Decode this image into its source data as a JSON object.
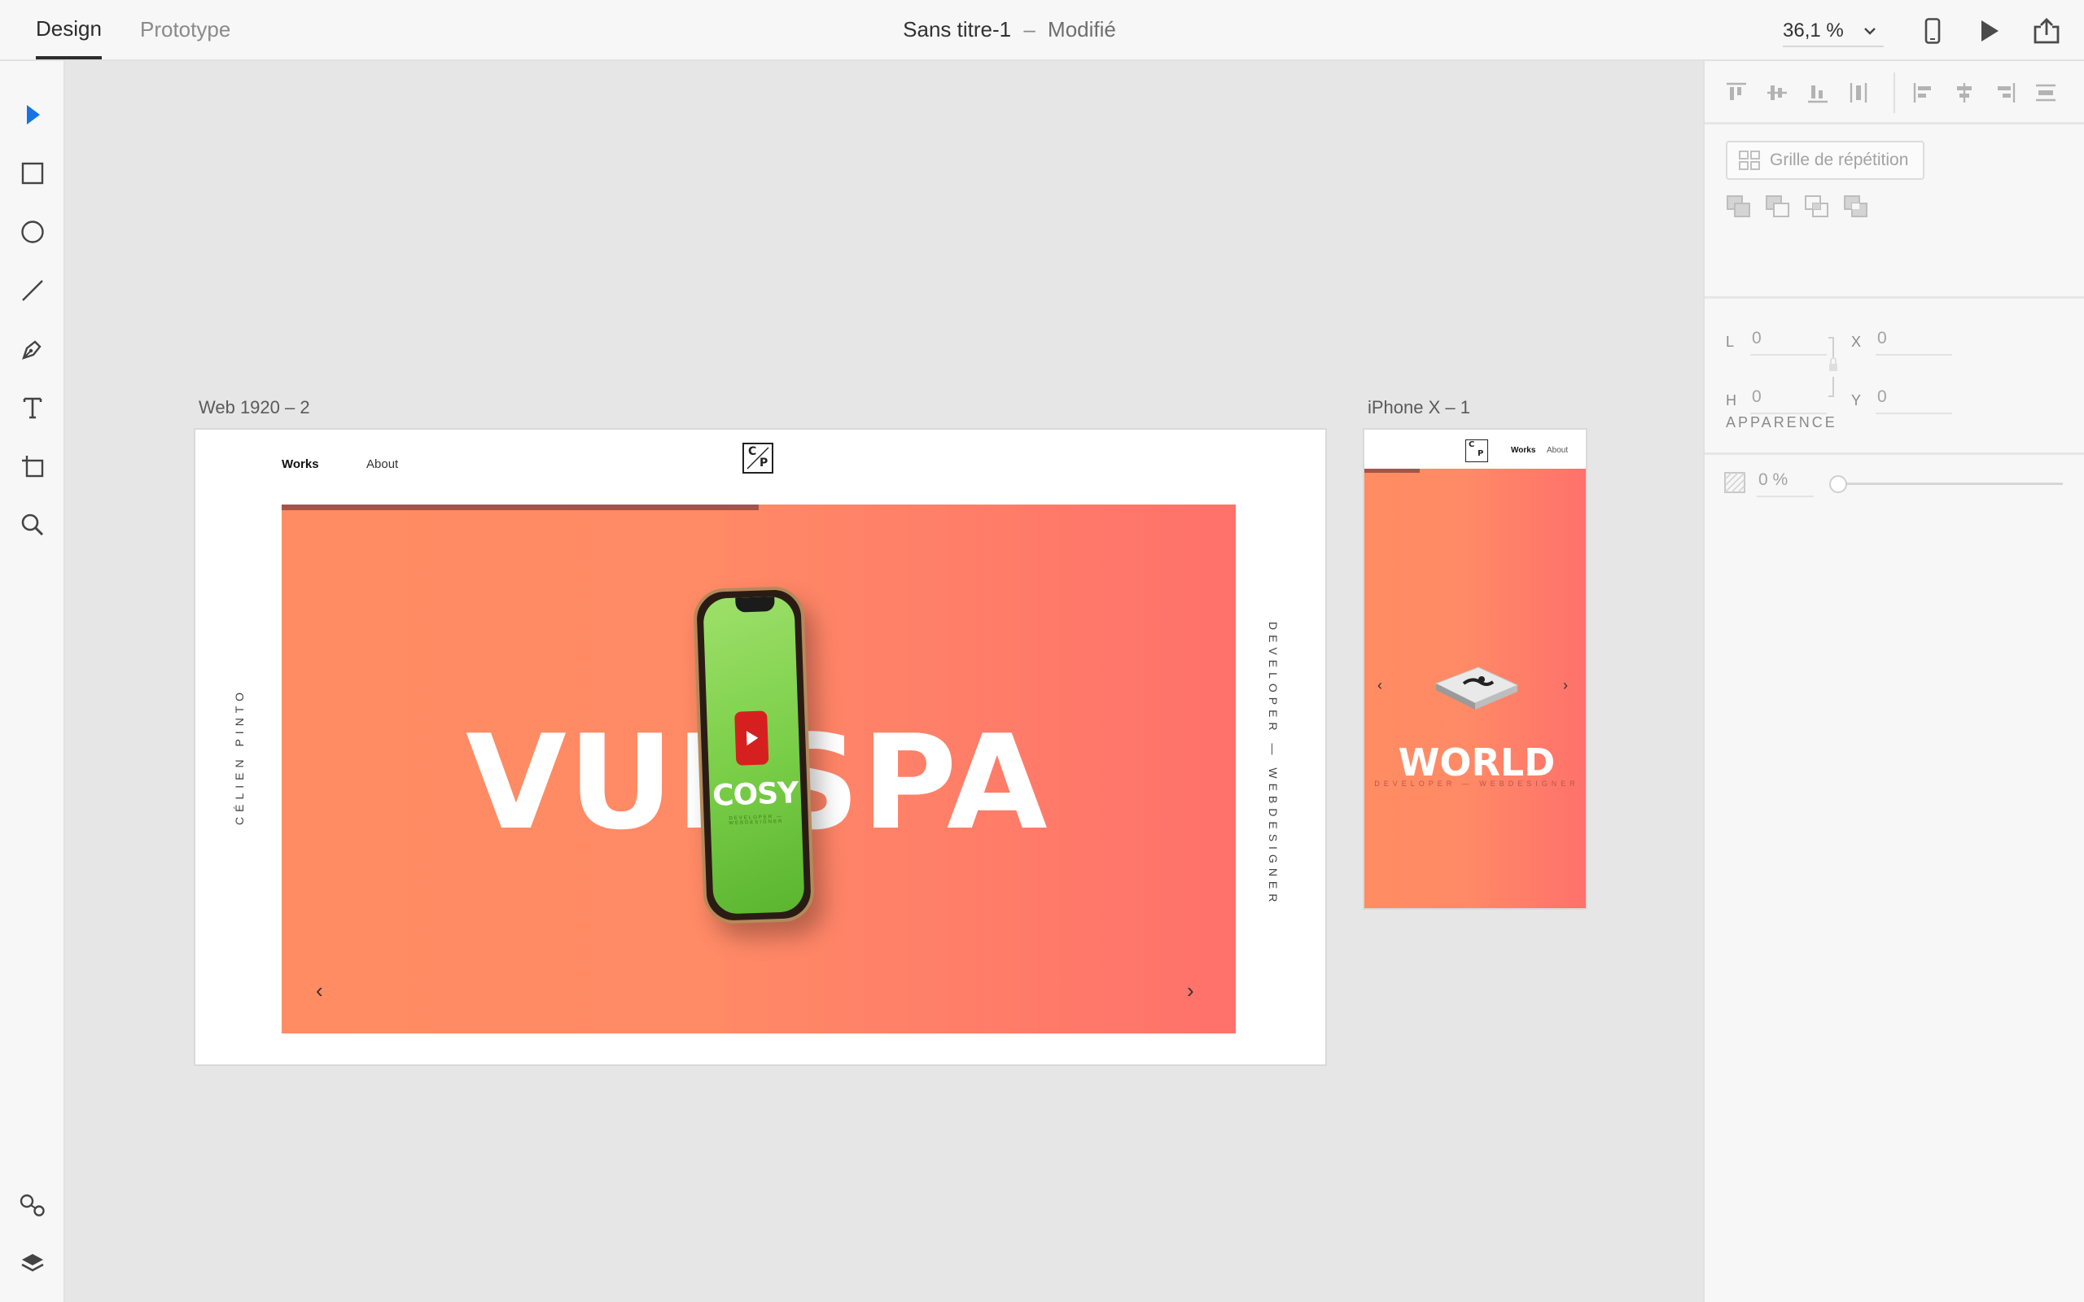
{
  "topbar": {
    "tabs": [
      {
        "label": "Design",
        "active": true
      },
      {
        "label": "Prototype",
        "active": false
      }
    ],
    "document_title": "Sans titre-1",
    "separator": "–",
    "status": "Modifié",
    "zoom": "36,1 %",
    "icons": [
      "chevron-down-icon",
      "mobile-preview-icon",
      "play-icon",
      "share-icon"
    ]
  },
  "toolbar": {
    "tools": [
      "select-tool-icon",
      "rectangle-tool-icon",
      "ellipse-tool-icon",
      "line-tool-icon",
      "pen-tool-icon",
      "text-tool-icon",
      "artboard-tool-icon",
      "zoom-tool-icon"
    ],
    "bottom": [
      "assets-icon",
      "layers-icon"
    ]
  },
  "panel": {
    "repeat_grid_label": "Grille de répétition",
    "fields": {
      "l_label": "L",
      "l_value": "0",
      "x_label": "X",
      "x_value": "0",
      "h_label": "H",
      "h_value": "0",
      "y_label": "Y",
      "y_value": "0"
    },
    "appearance_heading": "APPARENCE",
    "opacity_value": "0 %"
  },
  "canvas": {
    "web_artboard": {
      "label": "Web 1920 – 2",
      "nav_works": "Works",
      "nav_about": "About",
      "logo_top": "C",
      "logo_bottom": "P",
      "hero_word": "VUESPA",
      "phone_app_name": "COSY",
      "phone_app_sub": "DEVELOPER — WEBDESIGNER",
      "left_vertical": "CÉLIEN PINTO",
      "right_vertical": "DEVELOPER — WEBDESIGNER",
      "prev_arrow": "‹",
      "next_arrow": "›",
      "progress": 0.5
    },
    "iphone_artboard": {
      "label": "iPhone X – 1",
      "nav_works": "Works",
      "nav_about": "About",
      "logo_top": "C",
      "logo_bottom": "P",
      "hero_word": "WORLD",
      "hero_sub": "DEVELOPER — WEBDESIGNER",
      "prev_arrow": "‹",
      "next_arrow": "›",
      "progress": 0.25
    }
  },
  "colors": {
    "accent_blue": "#1473e6",
    "hero_gradient_start": "#ff8c62",
    "hero_gradient_end": "#ff716b",
    "progress_bar": "#a5544a",
    "phone_screen_green": "#7bcf49"
  }
}
